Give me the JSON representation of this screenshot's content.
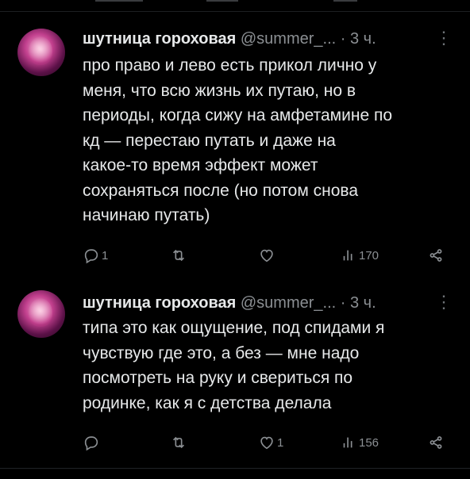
{
  "tweets": [
    {
      "author_name": "шутница гороховая",
      "handle": "@summer_...",
      "dot": "·",
      "time": "3 ч.",
      "more_icon": "more-dots-icon",
      "text": "про право и лево есть прикол лично у\nменя, что всю жизнь их путаю, но в\nпериоды, когда сижу на амфетамине по\nкд — перестаю путать и даже на\nкакое-то время эффект может\nсохраняться после (но потом снова\nначинаю путать)",
      "replies": "1",
      "retweets": "",
      "likes": "",
      "views": "170"
    },
    {
      "author_name": "шутница гороховая",
      "handle": "@summer_...",
      "dot": "·",
      "time": "3 ч.",
      "more_icon": "more-dots-icon",
      "text": "типа это как ощущение, под спидами я\nчувствую где это, а без — мне надо\nпосмотреть на руку и свериться по\nродинке, как я с детства делала",
      "replies": "",
      "retweets": "",
      "likes": "1",
      "views": "156"
    }
  ],
  "colors": {
    "background": "#000000",
    "text": "#e7e9ea",
    "secondary": "#8b8f93"
  }
}
